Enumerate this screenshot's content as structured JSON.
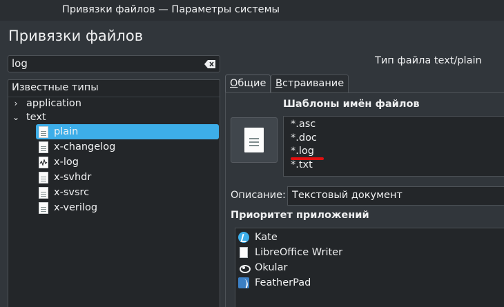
{
  "window": {
    "title": "Привязки файлов — Параметры системы"
  },
  "page": {
    "title": "Привязки файлов"
  },
  "search": {
    "value": "log",
    "clear_icon": "edit-clear-icon"
  },
  "tree": {
    "header": "Известные типы",
    "groups": [
      {
        "label": "application",
        "expanded": false
      },
      {
        "label": "text",
        "expanded": true
      }
    ],
    "children": [
      {
        "label": "plain",
        "icon": "text-document-icon",
        "selected": true
      },
      {
        "label": "x-changelog",
        "icon": "text-document-icon",
        "selected": false
      },
      {
        "label": "x-log",
        "icon": "log-file-icon",
        "selected": false
      },
      {
        "label": "x-svhdr",
        "icon": "text-document-icon",
        "selected": false
      },
      {
        "label": "x-svsrc",
        "icon": "text-document-icon",
        "selected": false
      },
      {
        "label": "x-verilog",
        "icon": "text-document-icon",
        "selected": false
      }
    ]
  },
  "detail": {
    "header": "Тип файла text/plain",
    "tabs": [
      {
        "label_u": "О",
        "label_rest": "бщие",
        "active": true
      },
      {
        "label_u": "В",
        "label_rest": "страивание",
        "active": false
      }
    ],
    "patterns_title": "Шаблоны имён файлов",
    "patterns": [
      "*.asc",
      "*.doc",
      "*.log",
      "*.txt"
    ],
    "description_label": "Описание:",
    "description_value": "Текстовый документ",
    "priority_title": "Приоритет приложений",
    "apps": [
      {
        "label": "Kate",
        "icon": "kate-icon"
      },
      {
        "label": "LibreOffice Writer",
        "icon": "libreoffice-writer-icon"
      },
      {
        "label": "Okular",
        "icon": "okular-icon"
      },
      {
        "label": "FeatherPad",
        "icon": "featherpad-icon"
      }
    ]
  },
  "colors": {
    "background": "#31363b",
    "selection": "#3daee9",
    "highlight_underline": "#e01010"
  }
}
